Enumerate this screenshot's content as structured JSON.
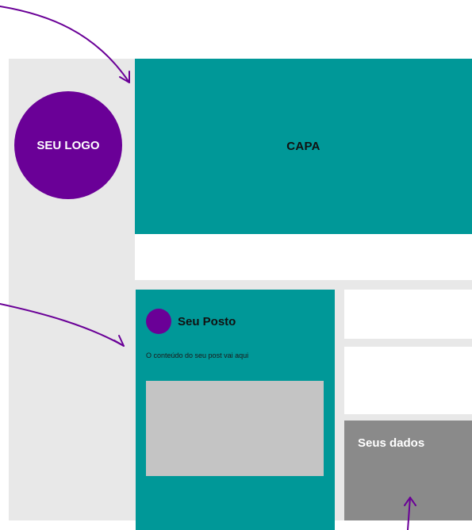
{
  "cover": {
    "label": "CAPA"
  },
  "logo": {
    "label": "SEU LOGO"
  },
  "post": {
    "title": "Seu Posto",
    "text": "O conteúdo do seu post vai aqui"
  },
  "data_card": {
    "label": "Seus dados"
  },
  "colors": {
    "teal": "#009898",
    "purple": "#6a0097",
    "panel_gray": "#e8e8e8",
    "placeholder_gray": "#c4c4c4",
    "data_gray": "#8a8a8a"
  },
  "icons": [
    "arrow-to-cover-icon",
    "arrow-to-post-icon",
    "arrow-to-data-icon"
  ]
}
